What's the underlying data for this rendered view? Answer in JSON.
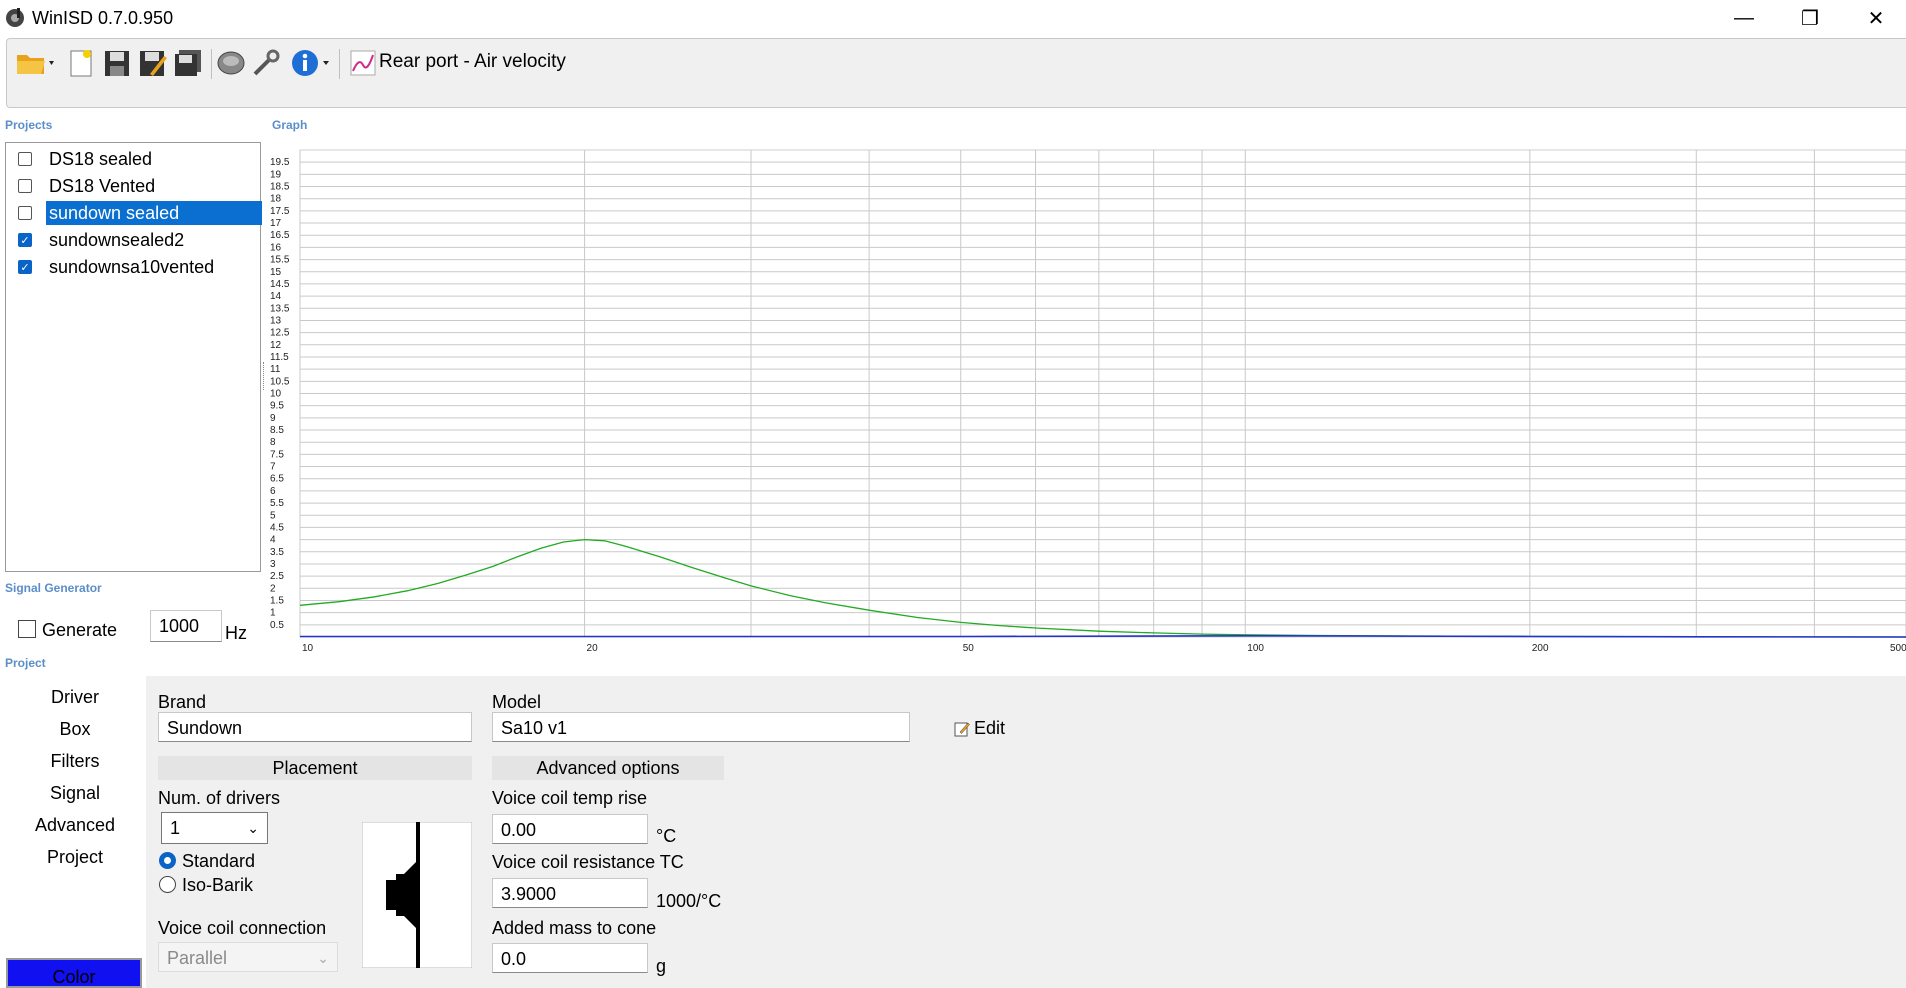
{
  "window": {
    "title": "WinISD 0.7.0.950",
    "minimize": "—",
    "restore": "❐",
    "close": "✕"
  },
  "toolbar": {
    "graph_selector": "Rear port - Air velocity",
    "icons": [
      "open-folder-icon",
      "new-project-icon",
      "save-icon",
      "save-as-icon",
      "save-all-icon",
      "driver-icon",
      "tools-icon",
      "info-icon",
      "graph-icon"
    ]
  },
  "sections": {
    "projects": "Projects",
    "graph": "Graph",
    "signal_generator": "Signal Generator",
    "project": "Project"
  },
  "projects": [
    {
      "name": "DS18 sealed",
      "checked": false,
      "selected": false
    },
    {
      "name": "DS18 Vented",
      "checked": false,
      "selected": false
    },
    {
      "name": "sundown sealed",
      "checked": false,
      "selected": true
    },
    {
      "name": "sundownsealed2",
      "checked": true,
      "selected": false
    },
    {
      "name": "sundownsa10vented",
      "checked": true,
      "selected": false
    }
  ],
  "signal_generator": {
    "generate_label": "Generate",
    "frequency": "1000",
    "unit": "Hz"
  },
  "chart_data": {
    "type": "line",
    "xscale": "log",
    "xlim": [
      10,
      500
    ],
    "ylim": [
      0,
      20
    ],
    "x_tick_labels": [
      "10",
      "20",
      "50",
      "100",
      "200",
      "500"
    ],
    "y_ticks": [
      0.5,
      1,
      1.5,
      2,
      2.5,
      3,
      3.5,
      4,
      4.5,
      5,
      5.5,
      6,
      6.5,
      7,
      7.5,
      8,
      8.5,
      9,
      9.5,
      10,
      10.5,
      11,
      11.5,
      12,
      12.5,
      13,
      13.5,
      14,
      14.5,
      15,
      15.5,
      16,
      16.5,
      17,
      17.5,
      18,
      18.5,
      19,
      19.5
    ],
    "grid": true,
    "series": [
      {
        "color": "#22aa22",
        "x": [
          10,
          11,
          12,
          13,
          14,
          15,
          16,
          17,
          18,
          19,
          20,
          21,
          22,
          24,
          26,
          28,
          30,
          33,
          36,
          40,
          45,
          50,
          55,
          60,
          70,
          80,
          90,
          100,
          120,
          150,
          200,
          300,
          500
        ],
        "y": [
          1.3,
          1.45,
          1.65,
          1.9,
          2.2,
          2.55,
          2.9,
          3.3,
          3.65,
          3.9,
          4.0,
          3.95,
          3.75,
          3.3,
          2.85,
          2.45,
          2.1,
          1.7,
          1.4,
          1.1,
          0.8,
          0.6,
          0.47,
          0.37,
          0.24,
          0.17,
          0.12,
          0.09,
          0.06,
          0.04,
          0.025,
          0.01,
          0.0
        ]
      },
      {
        "color": "#2233cc",
        "x": [
          10,
          20,
          50,
          100,
          130,
          200,
          300,
          500
        ],
        "y": [
          0.02,
          0.02,
          0.02,
          0.05,
          0.04,
          0.02,
          0.01,
          0.0
        ]
      }
    ]
  },
  "nav": [
    "Driver",
    "Box",
    "Filters",
    "Signal",
    "Advanced",
    "Project"
  ],
  "color_button": "Color",
  "driver": {
    "brand_label": "Brand",
    "brand": "Sundown",
    "model_label": "Model",
    "model": "Sa10 v1",
    "edit": "Edit",
    "placement_title": "Placement",
    "num_drivers_label": "Num. of drivers",
    "num_drivers": "1",
    "placement_standard": "Standard",
    "placement_isobarik": "Iso-Barik",
    "voice_coil_connection_label": "Voice coil connection",
    "voice_coil_connection": "Parallel",
    "advanced_title": "Advanced options",
    "vc_temp_rise_label": "Voice coil temp rise",
    "vc_temp_rise": "0.00",
    "vc_temp_unit": "°C",
    "vc_resistance_tc_label": "Voice coil resistance TC",
    "vc_resistance_tc": "3.9000",
    "vc_resistance_tc_unit": "1000/°C",
    "added_mass_label": "Added mass to cone",
    "added_mass": "0.0",
    "added_mass_unit": "g"
  }
}
